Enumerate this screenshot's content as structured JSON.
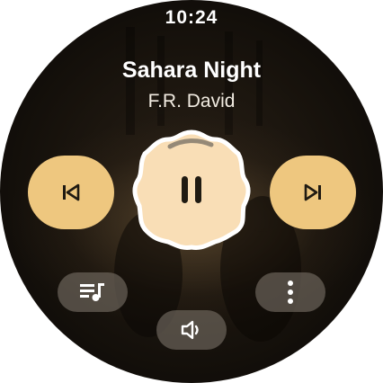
{
  "status": {
    "time": "10:24"
  },
  "now_playing": {
    "title": "Sahara Night",
    "artist": "F.R. David",
    "state": "playing"
  },
  "controls": {
    "previous_icon": "skip-previous-icon",
    "play_pause_icon": "pause-icon",
    "next_icon": "skip-next-icon",
    "queue_icon": "queue-music-icon",
    "volume_icon": "volume-icon",
    "more_icon": "more-vert-icon"
  },
  "colors": {
    "accent": "#eec77f",
    "play_button_fill": "#f9deb6",
    "play_button_outline": "#ffffff",
    "icon_dark": "#1f1a12",
    "pill_background": "#78706680"
  }
}
